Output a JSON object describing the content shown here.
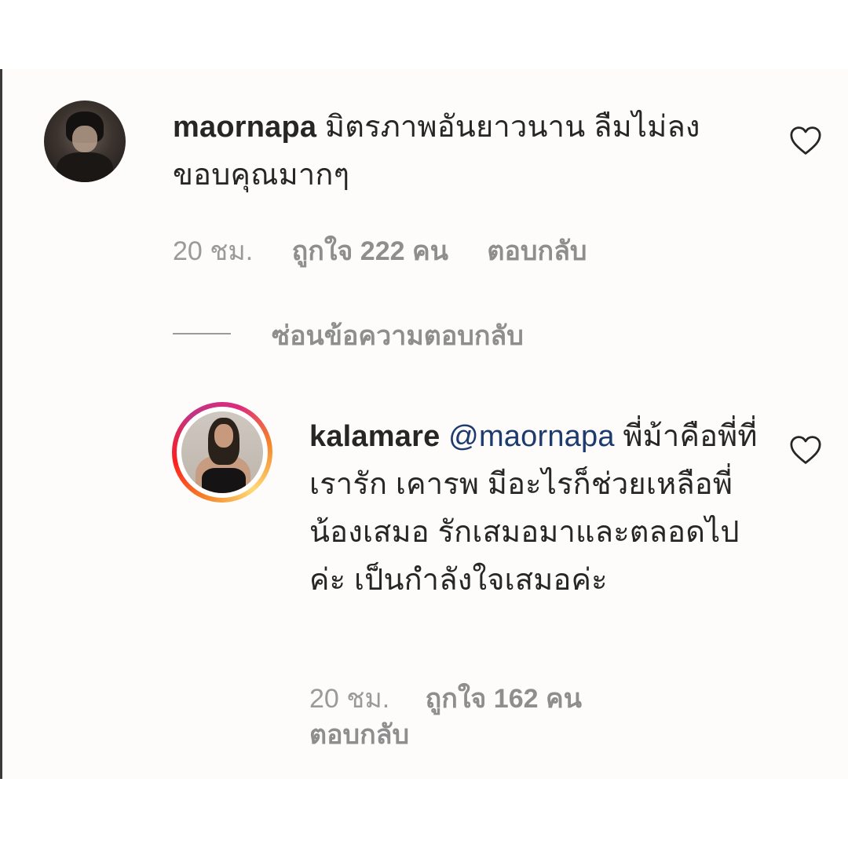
{
  "comments": [
    {
      "username": "maornapa",
      "text": "มิตรภาพอันยาวนาน ลืมไม่ลง ขอบคุณมากๆ",
      "time": "20 ชม.",
      "likes": "ถูกใจ 222 คน",
      "reply_label": "ตอบกลับ",
      "liked": false
    },
    {
      "username": "kalamare",
      "mention": "@maornapa",
      "text": "พี่ม้าคือพี่ที่เรารัก เคารพ มีอะไรก็ช่วยเหลือพี่น้องเสมอ รักเสมอมาและตลอดไปค่ะ เป็นกำลังใจเสมอค่ะ",
      "time": "20 ชม.",
      "likes": "ถูกใจ 162 คน",
      "reply_label": "ตอบกลับ",
      "liked": false,
      "has_story_ring": true
    }
  ],
  "hide_replies_label": "ซ่อนข้อความตอบกลับ",
  "colors": {
    "text": "#262626",
    "meta": "#8e8e8e",
    "mention": "#1e3b6e"
  },
  "icons": {
    "like": "heart-outline-icon"
  }
}
